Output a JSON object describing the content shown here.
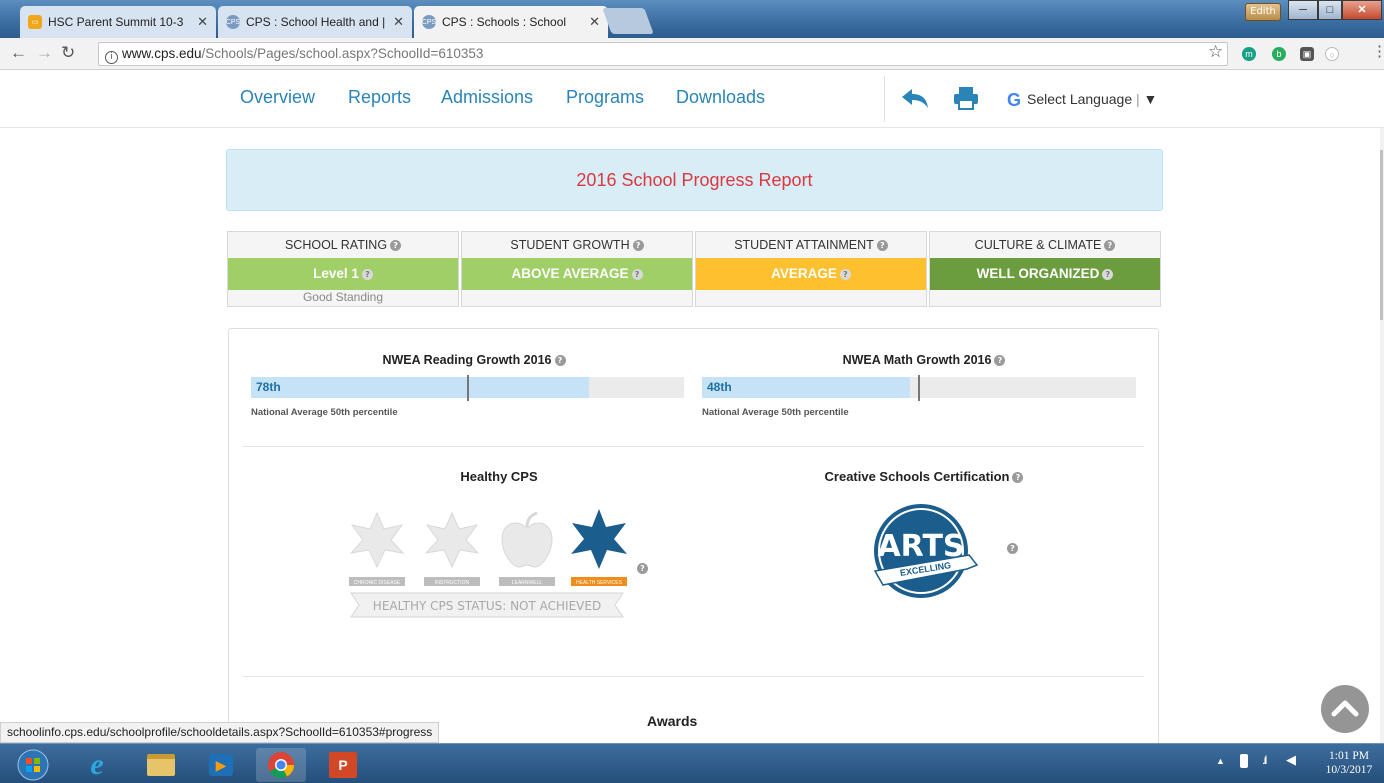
{
  "browser": {
    "tabs": [
      {
        "title": "HSC Parent Summit 10-3",
        "favicon_color": "#f2a71b",
        "active": false
      },
      {
        "title": "CPS : School Health and |",
        "favicon_color": "#7a9bbf",
        "active": false
      },
      {
        "title": "CPS : Schools : School",
        "favicon_color": "#7a9bbf",
        "active": true
      }
    ],
    "user_name": "Edith",
    "url_host": "www.cps.edu",
    "url_path": "/Schools/Pages/school.aspx?SchoolId=610353",
    "status_url": "schoolinfo.cps.edu/schoolprofile/schooldetails.aspx?SchoolId=610353#progress"
  },
  "site_nav": {
    "links": [
      "Overview",
      "Reports",
      "Admissions",
      "Programs",
      "Downloads"
    ],
    "select_language": "Select Language",
    "language_dropdown_glyph": "▼",
    "share_icon": "share-icon",
    "print_icon": "print-icon"
  },
  "report": {
    "title": "2016 School Progress Report",
    "ratings": [
      {
        "label": "SCHOOL RATING",
        "value": "Level 1",
        "note": "Good Standing",
        "color": "#a0cf67"
      },
      {
        "label": "STUDENT GROWTH",
        "value": "ABOVE AVERAGE",
        "note": "",
        "color": "#a0cf67"
      },
      {
        "label": "STUDENT ATTAINMENT",
        "value": "AVERAGE",
        "note": "",
        "color": "#fec02f"
      },
      {
        "label": "CULTURE & CLIMATE",
        "value": "WELL ORGANIZED",
        "note": "",
        "color": "#6b9c3e"
      }
    ],
    "reading": {
      "title": "NWEA Reading Growth 2016",
      "value_label": "78th",
      "percentile": 78,
      "national_note": "National Average 50th percentile",
      "national_percentile": 50
    },
    "math": {
      "title": "NWEA Math Growth 2016",
      "value_label": "48th",
      "percentile": 48,
      "national_note": "National Average 50th percentile",
      "national_percentile": 50
    },
    "healthy": {
      "title": "Healthy CPS",
      "badges": [
        {
          "label": "CHRONIC DISEASE",
          "achieved": false
        },
        {
          "label": "INSTRUCTION",
          "achieved": false
        },
        {
          "label": "LEARNWELL",
          "achieved": false
        },
        {
          "label": "HEALTH SERVICES",
          "achieved": true
        }
      ],
      "status": "HEALTHY CPS STATUS: NOT ACHIEVED"
    },
    "creative": {
      "title": "Creative Schools Certification",
      "badge_top": "ARTS",
      "badge_ribbon": "EXCELLING"
    },
    "awards_title": "Awards"
  },
  "taskbar": {
    "time": "1:01 PM",
    "date": "10/3/2017"
  }
}
